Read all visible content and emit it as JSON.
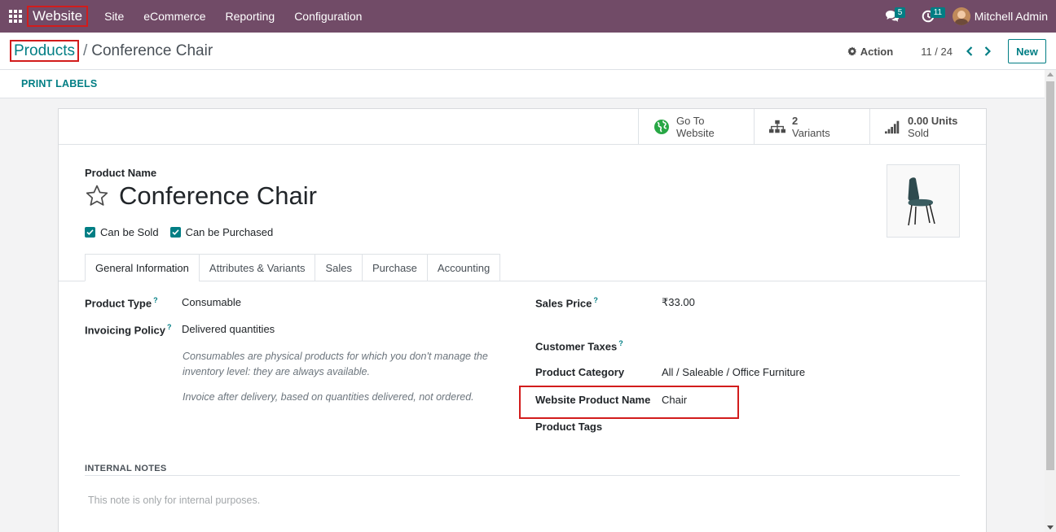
{
  "navbar": {
    "brand": "Website",
    "menu": [
      "Site",
      "eCommerce",
      "Reporting",
      "Configuration"
    ],
    "messages_count": "5",
    "activities_count": "11",
    "user_name": "Mitchell Admin"
  },
  "breadcrumb": {
    "parent": "Products",
    "separator": "/",
    "current": "Conference Chair"
  },
  "control_panel": {
    "action_label": "Action",
    "pager": "11 / 24",
    "new_label": "New"
  },
  "statusbar": {
    "print_labels": "PRINT LABELS"
  },
  "smart_buttons": {
    "website": {
      "line1": "Go To",
      "line2": "Website"
    },
    "variants": {
      "value": "2",
      "label": "Variants"
    },
    "sold": {
      "value": "0.00 Units",
      "label": "Sold"
    }
  },
  "product": {
    "name_label": "Product Name",
    "name": "Conference Chair",
    "can_be_sold": "Can be Sold",
    "can_be_purchased": "Can be Purchased"
  },
  "tabs": [
    "General Information",
    "Attributes & Variants",
    "Sales",
    "Purchase",
    "Accounting"
  ],
  "fields": {
    "product_type": {
      "label": "Product Type",
      "value": "Consumable"
    },
    "invoicing_policy": {
      "label": "Invoicing Policy",
      "value": "Delivered quantities"
    },
    "help_consumable_1": "Consumables are physical products for which you don't manage the",
    "help_consumable_2": "inventory level: they are always available.",
    "help_invoice": "Invoice after delivery, based on quantities delivered, not ordered.",
    "sales_price": {
      "label": "Sales Price",
      "value": "₹33.00"
    },
    "customer_taxes": {
      "label": "Customer Taxes",
      "value": ""
    },
    "product_category": {
      "label": "Product Category",
      "value": "All / Saleable / Office Furniture"
    },
    "website_product_name": {
      "label": "Website Product Name",
      "value": "Chair"
    },
    "product_tags": {
      "label": "Product Tags",
      "value": ""
    },
    "help_marker": "?"
  },
  "notes": {
    "title": "INTERNAL NOTES",
    "placeholder": "This note is only for internal purposes."
  },
  "colors": {
    "navbar": "#714b67",
    "accent": "#017e84",
    "highlight": "#d21c1c"
  }
}
